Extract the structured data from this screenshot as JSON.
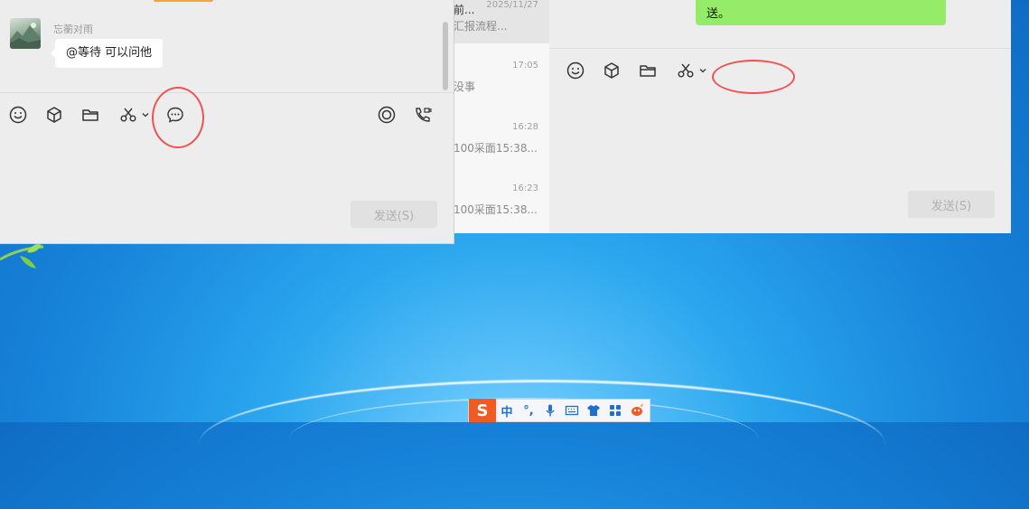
{
  "left_window": {
    "sender_name": "忘蘅对雨",
    "message_text": "@等待 可以问他",
    "send_label": "发送(S)"
  },
  "conversation_list": {
    "items": [
      {
        "title_fragment": "前...",
        "time": "2025/11/27",
        "preview": "汇报流程..."
      },
      {
        "time": "17:05",
        "preview": "没事"
      },
      {
        "time": "16:28",
        "preview": "100采面15:38..."
      },
      {
        "time": "16:23",
        "preview": "100采面15:38..."
      }
    ]
  },
  "right_window": {
    "message_text": "送。",
    "send_label": "发送(S)"
  },
  "ime_bar": {
    "logo": "S",
    "mode": "中",
    "punct": "°,"
  },
  "colors": {
    "bubble_green": "#95ec69",
    "annotation_red": "#ef5350",
    "ime_brand": "#f25a24"
  },
  "icons": [
    "emoji-icon",
    "cube-icon",
    "folder-icon",
    "scissors-icon",
    "chat-history-icon",
    "live-icon",
    "video-call-icon"
  ]
}
